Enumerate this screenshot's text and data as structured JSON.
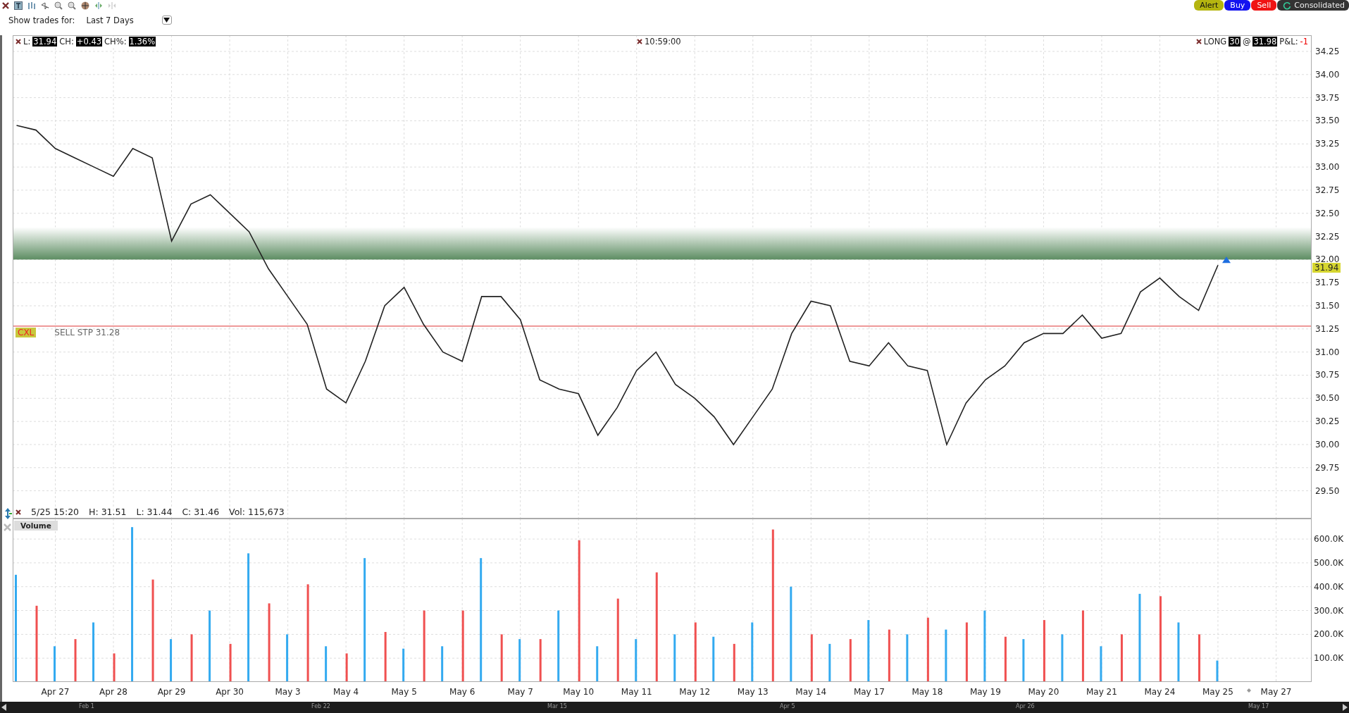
{
  "toolbar": {
    "buttons": [
      {
        "label": "Alert",
        "kind": "alert"
      },
      {
        "label": "Buy",
        "kind": "buy"
      },
      {
        "label": "Sell",
        "kind": "sell"
      },
      {
        "label": "Consolidated",
        "kind": "feed"
      }
    ]
  },
  "trades_filter": {
    "label": "Show trades for:",
    "value": "Last 7 Days"
  },
  "price_panel": {
    "quote": [
      {
        "label": "L:",
        "value": "31.94"
      },
      {
        "label": "CH:",
        "value": "+0.43"
      },
      {
        "label": "CH%:",
        "value": "1.36%"
      }
    ],
    "time": "10:59:00",
    "position": {
      "side": "LONG",
      "qty": "30",
      "at": "@",
      "price": "31.98",
      "pnl_label": "P&L:",
      "pnl": "-1"
    },
    "last_price_tag": "31.94",
    "order": {
      "tag": "CXL"
    },
    "bar_info": {
      "time": "5/25 15:20",
      "fields": [
        "H: 31.51",
        "L: 31.44",
        "C: 31.46",
        "Vol: 115,673"
      ]
    },
    "chart_data": {
      "type": "line",
      "grid": true,
      "ylim": [
        29.2,
        34.425
      ],
      "categories": [
        null,
        null,
        null,
        null,
        null,
        null,
        null,
        null,
        null,
        null,
        null,
        null,
        null,
        null,
        null,
        null,
        null,
        null,
        null,
        null,
        null,
        null,
        null,
        null,
        null,
        null,
        null,
        null,
        null,
        null,
        null,
        null,
        null,
        null,
        null,
        null,
        null,
        null,
        null,
        null,
        null,
        null,
        null,
        null,
        null,
        null,
        null,
        null,
        null,
        null,
        null,
        null,
        null,
        null,
        null,
        null,
        null,
        null,
        null,
        null,
        null,
        null,
        null
      ],
      "yticks": [
        {
          "value": 29.5,
          "label": "29.50"
        },
        {
          "value": 29.75,
          "label": "29.75"
        },
        {
          "value": 30,
          "label": "30.00"
        },
        {
          "value": 30.25,
          "label": "30.25"
        },
        {
          "value": 30.5,
          "label": "30.50"
        },
        {
          "value": 30.75,
          "label": "30.75"
        },
        {
          "value": 31,
          "label": "31.00"
        },
        {
          "value": 31.25,
          "label": "31.25"
        },
        {
          "value": 31.5,
          "label": "31.50"
        },
        {
          "value": 31.75,
          "label": "31.75"
        },
        {
          "value": 32,
          "label": "32.00"
        },
        {
          "value": 32.25,
          "label": "32.25"
        },
        {
          "value": 32.5,
          "label": "32.50"
        },
        {
          "value": 32.75,
          "label": "32.75"
        },
        {
          "value": 33,
          "label": "33.00"
        },
        {
          "value": 33.25,
          "label": "33.25"
        },
        {
          "value": 33.5,
          "label": "33.50"
        },
        {
          "value": 33.75,
          "label": "33.75"
        },
        {
          "value": 34,
          "label": "34.00"
        },
        {
          "value": 34.25,
          "label": "34.25"
        }
      ],
      "series": [
        {
          "color": "#222222",
          "values": [
            33.45,
            33.4,
            33.2,
            33.1,
            33.0,
            32.9,
            33.2,
            33.1,
            32.2,
            32.6,
            32.7,
            32.5,
            32.3,
            31.9,
            31.6,
            31.3,
            30.6,
            30.45,
            30.9,
            31.5,
            31.7,
            31.3,
            31.0,
            30.9,
            31.6,
            31.6,
            31.35,
            30.7,
            30.6,
            30.55,
            30.1,
            30.4,
            30.8,
            31.0,
            30.65,
            30.5,
            30.3,
            30.0,
            30.3,
            30.6,
            31.2,
            31.55,
            31.5,
            30.9,
            30.85,
            31.1,
            30.85,
            30.8,
            30.0,
            30.45,
            30.7,
            30.85,
            31.1,
            31.2,
            31.2,
            31.4,
            31.15,
            31.2,
            31.65,
            31.8,
            31.6,
            31.45,
            31.94
          ]
        }
      ],
      "ref_lines": [
        {
          "axis": "y",
          "value": 31.28,
          "label": "SELL STP 31.28",
          "color": "#dd3333"
        }
      ]
    }
  },
  "volume_panel": {
    "title": "Volume",
    "chart_data": {
      "type": "bar",
      "grid": true,
      "ylim": [
        0,
        686
      ],
      "categories": [
        null,
        null,
        "Apr 27",
        null,
        null,
        "Apr 28",
        null,
        null,
        "Apr 29",
        null,
        null,
        "Apr 30",
        null,
        null,
        "May 3",
        null,
        null,
        "May 4",
        null,
        null,
        "May 5",
        null,
        null,
        "May 6",
        null,
        null,
        "May 7",
        null,
        null,
        "May 10",
        null,
        null,
        "May 11",
        null,
        null,
        "May 12",
        null,
        null,
        "May 13",
        null,
        null,
        "May 14",
        null,
        null,
        "May 17",
        null,
        null,
        "May 18",
        null,
        null,
        "May 19",
        null,
        null,
        "May 20",
        null,
        null,
        "May 21",
        null,
        null,
        "May 24",
        null,
        null,
        "May 25",
        null,
        null,
        "May 27"
      ],
      "yticks": [
        {
          "value": 100,
          "label": "100.0K"
        },
        {
          "value": 200,
          "label": "200.0K"
        },
        {
          "value": 300,
          "label": "300.0K"
        },
        {
          "value": 400,
          "label": "400.0K"
        },
        {
          "value": 500,
          "label": "500.0K"
        },
        {
          "value": 600,
          "label": "600.0K"
        }
      ],
      "series": [
        {
          "color": "#33aaf0",
          "values": [
            450,
            null,
            150,
            null,
            250,
            null,
            650,
            null,
            180,
            null,
            300,
            null,
            540,
            null,
            200,
            null,
            150,
            null,
            520,
            null,
            140,
            null,
            150,
            null,
            520,
            null,
            180,
            null,
            300,
            null,
            150,
            null,
            180,
            null,
            200,
            null,
            190,
            null,
            250,
            null,
            400,
            null,
            160,
            null,
            260,
            null,
            200,
            null,
            220,
            null,
            300,
            null,
            180,
            null,
            200,
            null,
            150,
            null,
            370,
            null,
            250,
            null,
            90,
            null,
            null,
            null
          ]
        },
        {
          "color": "#f05050",
          "values": [
            null,
            320,
            null,
            180,
            null,
            120,
            null,
            430,
            null,
            200,
            null,
            160,
            null,
            330,
            null,
            410,
            null,
            120,
            null,
            210,
            null,
            300,
            null,
            300,
            null,
            200,
            null,
            180,
            null,
            595,
            null,
            350,
            null,
            460,
            null,
            250,
            null,
            160,
            null,
            640,
            null,
            200,
            null,
            180,
            null,
            220,
            null,
            270,
            null,
            250,
            null,
            190,
            null,
            260,
            null,
            300,
            null,
            200,
            null,
            360,
            null,
            200,
            null,
            null,
            null,
            null
          ]
        }
      ]
    }
  },
  "scrollbar": {
    "labels": [
      "Feb 1",
      "Feb 22",
      "Mar 15",
      "Apr 5",
      "Apr 26",
      "May 17"
    ]
  }
}
